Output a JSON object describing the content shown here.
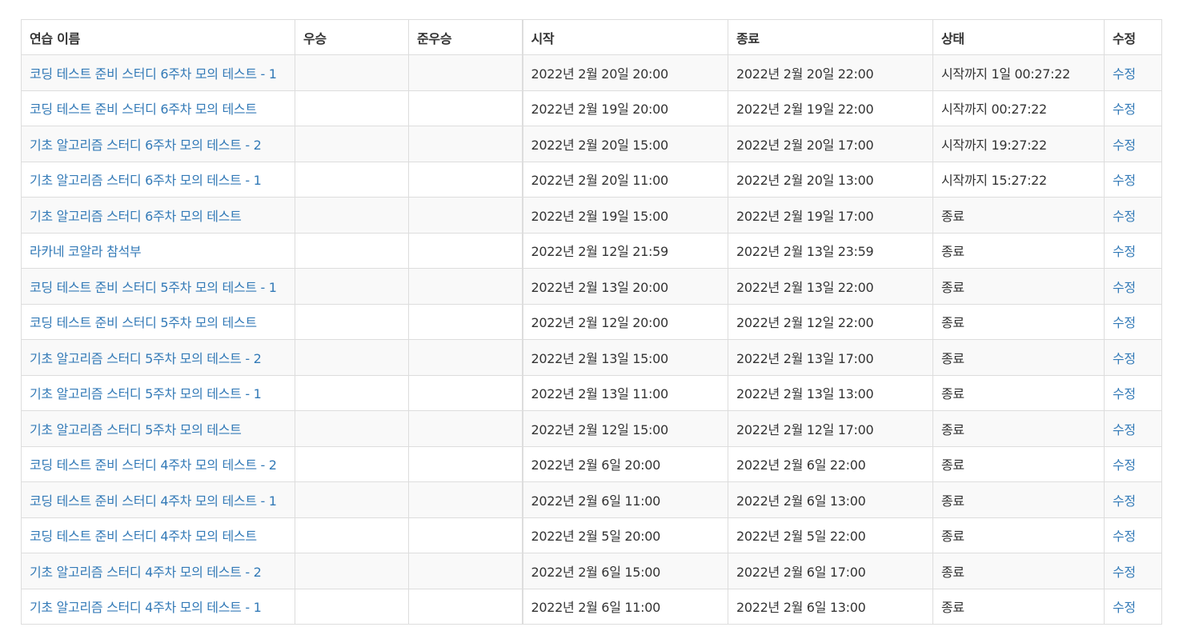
{
  "table": {
    "headers": {
      "name": "연습 이름",
      "winner": "우승",
      "runner_up": "준우승",
      "start": "시작",
      "end": "종료",
      "status": "상태",
      "edit": "수정"
    },
    "rows": [
      {
        "name": "코딩 테스트 준비 스터디 6주차 모의 테스트 - 1",
        "winner": "",
        "runner_up": "",
        "start": "2022년 2월 20일 20:00",
        "end": "2022년 2월 20일 22:00",
        "status": "시작까지 1일 00:27:22",
        "edit": "수정"
      },
      {
        "name": "코딩 테스트 준비 스터디 6주차 모의 테스트",
        "winner": "",
        "runner_up": "",
        "start": "2022년 2월 19일 20:00",
        "end": "2022년 2월 19일 22:00",
        "status": "시작까지 00:27:22",
        "edit": "수정"
      },
      {
        "name": "기초 알고리즘 스터디 6주차 모의 테스트 - 2",
        "winner": "",
        "runner_up": "",
        "start": "2022년 2월 20일 15:00",
        "end": "2022년 2월 20일 17:00",
        "status": "시작까지 19:27:22",
        "edit": "수정"
      },
      {
        "name": "기초 알고리즘 스터디 6주차 모의 테스트 - 1",
        "winner": "",
        "runner_up": "",
        "start": "2022년 2월 20일 11:00",
        "end": "2022년 2월 20일 13:00",
        "status": "시작까지 15:27:22",
        "edit": "수정"
      },
      {
        "name": "기초 알고리즘 스터디 6주차 모의 테스트",
        "winner": "",
        "runner_up": "",
        "start": "2022년 2월 19일 15:00",
        "end": "2022년 2월 19일 17:00",
        "status": "종료",
        "edit": "수정"
      },
      {
        "name": "라카네 코알라 참석부",
        "winner": "",
        "runner_up": "",
        "start": "2022년 2월 12일 21:59",
        "end": "2022년 2월 13일 23:59",
        "status": "종료",
        "edit": "수정"
      },
      {
        "name": "코딩 테스트 준비 스터디 5주차 모의 테스트 - 1",
        "winner": "",
        "runner_up": "",
        "start": "2022년 2월 13일 20:00",
        "end": "2022년 2월 13일 22:00",
        "status": "종료",
        "edit": "수정"
      },
      {
        "name": "코딩 테스트 준비 스터디 5주차 모의 테스트",
        "winner": "",
        "runner_up": "",
        "start": "2022년 2월 12일 20:00",
        "end": "2022년 2월 12일 22:00",
        "status": "종료",
        "edit": "수정"
      },
      {
        "name": "기초 알고리즘 스터디 5주차 모의 테스트 - 2",
        "winner": "",
        "runner_up": "",
        "start": "2022년 2월 13일 15:00",
        "end": "2022년 2월 13일 17:00",
        "status": "종료",
        "edit": "수정"
      },
      {
        "name": "기초 알고리즘 스터디 5주차 모의 테스트 - 1",
        "winner": "",
        "runner_up": "",
        "start": "2022년 2월 13일 11:00",
        "end": "2022년 2월 13일 13:00",
        "status": "종료",
        "edit": "수정"
      },
      {
        "name": "기초 알고리즘 스터디 5주차 모의 테스트",
        "winner": "",
        "runner_up": "",
        "start": "2022년 2월 12일 15:00",
        "end": "2022년 2월 12일 17:00",
        "status": "종료",
        "edit": "수정"
      },
      {
        "name": "코딩 테스트 준비 스터디 4주차 모의 테스트 - 2",
        "winner": "",
        "runner_up": "",
        "start": "2022년 2월 6일 20:00",
        "end": "2022년 2월 6일 22:00",
        "status": "종료",
        "edit": "수정"
      },
      {
        "name": "코딩 테스트 준비 스터디 4주차 모의 테스트 - 1",
        "winner": "",
        "runner_up": "",
        "start": "2022년 2월 6일 11:00",
        "end": "2022년 2월 6일 13:00",
        "status": "종료",
        "edit": "수정"
      },
      {
        "name": "코딩 테스트 준비 스터디 4주차 모의 테스트",
        "winner": "",
        "runner_up": "",
        "start": "2022년 2월 5일 20:00",
        "end": "2022년 2월 5일 22:00",
        "status": "종료",
        "edit": "수정"
      },
      {
        "name": "기초 알고리즘 스터디 4주차 모의 테스트 - 2",
        "winner": "",
        "runner_up": "",
        "start": "2022년 2월 6일 15:00",
        "end": "2022년 2월 6일 17:00",
        "status": "종료",
        "edit": "수정"
      },
      {
        "name": "기초 알고리즘 스터디 4주차 모의 테스트 - 1",
        "winner": "",
        "runner_up": "",
        "start": "2022년 2월 6일 11:00",
        "end": "2022년 2월 6일 13:00",
        "status": "종료",
        "edit": "수정"
      }
    ]
  }
}
